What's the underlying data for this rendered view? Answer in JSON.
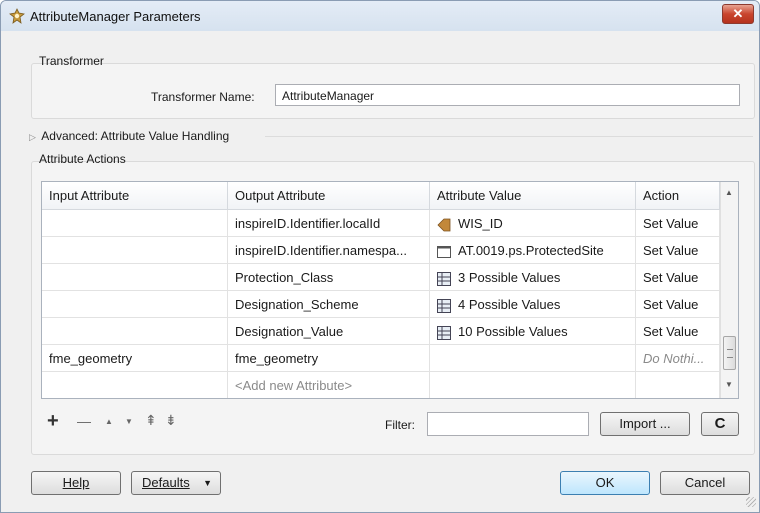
{
  "window": {
    "title": "AttributeManager Parameters",
    "close_label": "✕"
  },
  "transformer": {
    "group_label": "Transformer",
    "name_label": "Transformer Name:",
    "name_value": "AttributeManager"
  },
  "advanced": {
    "label": "Advanced: Attribute Value Handling"
  },
  "actions": {
    "group_label": "Attribute Actions",
    "columns": [
      "Input Attribute",
      "Output Attribute",
      "Attribute Value",
      "Action"
    ],
    "rows": [
      {
        "input": "",
        "output": "inspireID.Identifier.localId",
        "value_icon": "attribute-arrow-icon",
        "value": "WIS_ID",
        "action": "Set Value"
      },
      {
        "input": "",
        "output": "inspireID.Identifier.namespa...",
        "value_icon": "text-value-icon",
        "value": "AT.0019.ps.ProtectedSite",
        "action": "Set Value"
      },
      {
        "input": "",
        "output": "Protection_Class",
        "value_icon": "table-values-icon",
        "value": "3 Possible Values",
        "action": "Set Value"
      },
      {
        "input": "",
        "output": "Designation_Scheme",
        "value_icon": "table-values-icon",
        "value": "4 Possible Values",
        "action": "Set Value"
      },
      {
        "input": "",
        "output": "Designation_Value",
        "value_icon": "table-values-icon",
        "value": "10 Possible Values",
        "action": "Set Value"
      },
      {
        "input": "fme_geometry",
        "output": "fme_geometry",
        "value_icon": "",
        "value": "",
        "action": "Do Nothi..."
      }
    ],
    "add_new": "<Add new Attribute>"
  },
  "toolbar": {
    "add": "+",
    "remove": "—",
    "up": "▲",
    "down": "▼",
    "top": "⇞",
    "bottom": "⇟",
    "filter_label": "Filter:",
    "filter_value": "",
    "import_label": "Import ...",
    "refresh_label": "C"
  },
  "footer": {
    "help_label": "Help",
    "defaults_label": "Defaults",
    "ok_label": "OK",
    "cancel_label": "Cancel"
  },
  "colors": {
    "ok_border": "#3c7fb1",
    "close_red": "#c9452e",
    "icon_orange": "#c2883a"
  }
}
